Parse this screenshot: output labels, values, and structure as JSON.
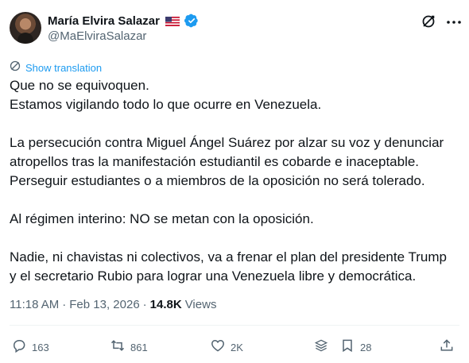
{
  "author": {
    "display_name": "María Elvira Salazar",
    "handle": "@MaElvira Salazar",
    "flag_icon": "us-flag-icon",
    "verified_color": "#1d9bf0"
  },
  "translation": {
    "label": "Show translation"
  },
  "post": {
    "lines": [
      "Que no se equivoquen.",
      "Estamos vigilando todo lo que ocurre en Venezuela.",
      "",
      "La persecución contra Miguel Ángel Suárez por alzar su voz y denunciar",
      "atropellos tras la manifestación estudiantil es cobarde e inaceptable.",
      "Perseguir estudiantes o a miembros de la oposición no será tolerado.",
      "",
      "Al régimen interino: NO se metan con la oposición.",
      "",
      "Nadie, ni chavistas ni colectivos, va a frenar el plan del presidente Trump",
      "y el secretario Rubio para lograr una Venezuela libre y democrática."
    ]
  },
  "meta": {
    "time": "11:18 AM",
    "separator": "·",
    "date": "Feb 13, 2026",
    "separator2": "·",
    "views_count": "14.8K",
    "views_label": "Views"
  },
  "actions": {
    "replies": "163",
    "reposts": "861",
    "likes": "2K",
    "bookmarks": "28"
  },
  "colors": {
    "text": "#0f1419",
    "secondary": "#536471",
    "accent": "#1d9bf0"
  }
}
